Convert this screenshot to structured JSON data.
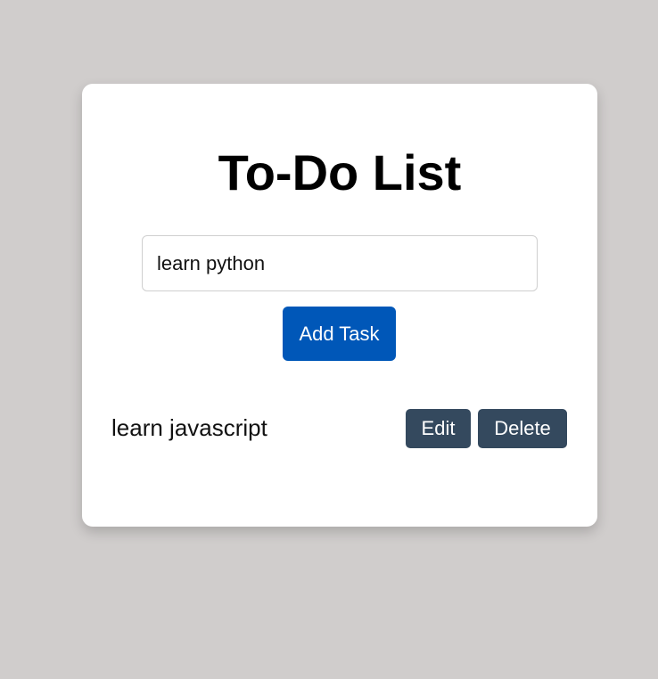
{
  "app": {
    "title": "To-Do List"
  },
  "input": {
    "value": "learn python",
    "placeholder": ""
  },
  "add_button": {
    "label": "Add Task"
  },
  "tasks": [
    {
      "text": "learn javascript",
      "edit_label": "Edit",
      "delete_label": "Delete"
    }
  ],
  "colors": {
    "background": "#d0cdcc",
    "card": "#ffffff",
    "primary": "#0057b8",
    "secondary": "#34495e"
  }
}
